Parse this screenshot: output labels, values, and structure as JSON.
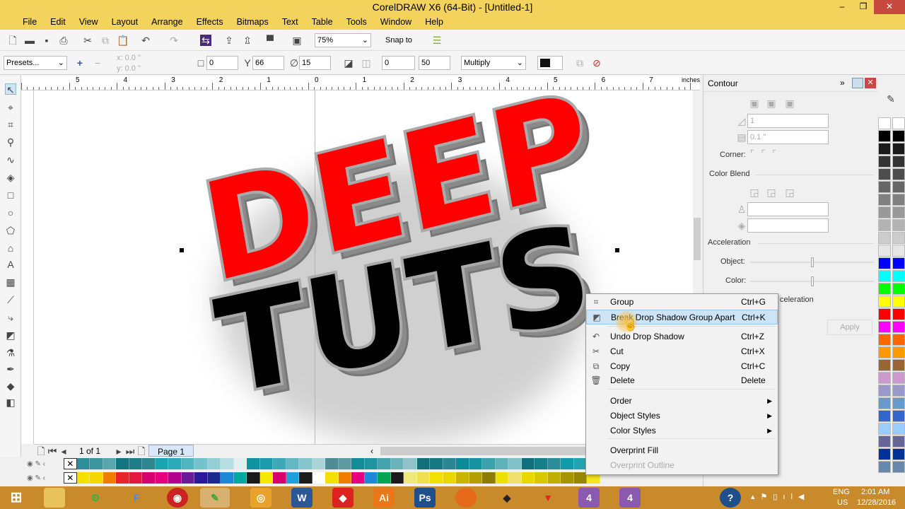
{
  "window": {
    "title": "CorelDRAW X6 (64-Bit) - [Untitled-1]",
    "minimize": "–",
    "restore": "❐",
    "close": "✕"
  },
  "menu": [
    "File",
    "Edit",
    "View",
    "Layout",
    "Arrange",
    "Effects",
    "Bitmaps",
    "Text",
    "Table",
    "Tools",
    "Window",
    "Help"
  ],
  "toolbar": {
    "zoom": "75%",
    "snap_to": "Snap to"
  },
  "property_bar": {
    "presets": "Presets...",
    "x": "x: 0.0 \"",
    "y": "y: 0.0 \"",
    "offset": "0",
    "opacity": "66",
    "feather": "15",
    "fade": "0",
    "stretch": "50",
    "merge_mode": "Multiply"
  },
  "ruler": {
    "unit": "inches",
    "labels": [
      "5",
      "4",
      "3",
      "2",
      "1",
      "0",
      "1",
      "2",
      "3",
      "4",
      "5",
      "6",
      "7"
    ]
  },
  "artwork": {
    "line1": "DEEP",
    "line2": "TUTS",
    "colors": {
      "red": "#ff0000",
      "black": "#000000",
      "extrude": "#9a9a9a"
    }
  },
  "page_nav": {
    "count": "1 of 1",
    "tab": "Page 1"
  },
  "docker": {
    "title": "Contour",
    "steps": "1",
    "offset": "0.1 \"",
    "corner": "Corner:",
    "color_blend": "Color Blend",
    "acceleration": "Acceleration",
    "object": "Object:",
    "color": "Color:",
    "link_accel": "celeration",
    "apply": "Apply",
    "object_accel": 0.5,
    "color_accel": 0.5
  },
  "context_menu": {
    "items": [
      {
        "label": "Group",
        "shortcut": "Ctrl+G",
        "icon": "group-icon"
      },
      {
        "label": "Break Drop Shadow Group Apart",
        "shortcut": "Ctrl+K",
        "icon": "break-apart-icon",
        "selected": true
      },
      {
        "label": "Undo Drop Shadow",
        "shortcut": "Ctrl+Z",
        "icon": "undo-icon"
      },
      {
        "label": "Cut",
        "shortcut": "Ctrl+X",
        "icon": "scissors-icon"
      },
      {
        "label": "Copy",
        "shortcut": "Ctrl+C",
        "icon": "copy-icon"
      },
      {
        "label": "Delete",
        "shortcut": "Delete",
        "icon": "trash-icon"
      },
      {
        "label": "Order",
        "submenu": true
      },
      {
        "label": "Object Styles",
        "submenu": true
      },
      {
        "label": "Color Styles",
        "submenu": true
      },
      {
        "label": "Overprint Fill"
      },
      {
        "label": "Overprint Outline",
        "disabled": true
      }
    ]
  },
  "palette_row1": [
    "#2f8f99",
    "#3b96a0",
    "#5aa6ae",
    "#137580",
    "#1d7d88",
    "#2e8690",
    "#19a3b3",
    "#2aaab8",
    "#4fb5c0",
    "#74c2cb",
    "#94cfd6",
    "#b5dde2",
    "#e0f0f2",
    "#0f93a3",
    "#1a9aaa",
    "#3ea9b6",
    "#62b7c2",
    "#85c5cd",
    "#a9d4da",
    "#4f8d96",
    "#5f99a1",
    "#138c98",
    "#1f939f",
    "#45a3ad",
    "#6bb3bb",
    "#90c3c9",
    "#116f7a",
    "#167a85",
    "#2a8792",
    "#0b8a98",
    "#1693a0",
    "#3aa2ad",
    "#5fb1ba",
    "#82c1c8",
    "#0f6f7b",
    "#15808c",
    "#2a8e98",
    "#109aaa",
    "#22a4b3",
    "#48b0bc"
  ],
  "palette_row2": [
    "#f5e000",
    "#f5d800",
    "#f07d00",
    "#e8232a",
    "#e5173f",
    "#d6006f",
    "#e4007e",
    "#b2008f",
    "#6a1b9a",
    "#2a1a9a",
    "#1d2a8f",
    "#1e88d8",
    "#00a99d",
    "#1a1a1a",
    "#f5e800",
    "#d6006f",
    "#1ea0dc",
    "#1a1a1a",
    "#ffffff",
    "#f5e000",
    "#f07d00",
    "#e4007e",
    "#1e88d8",
    "#00a651",
    "#1a1a1a",
    "#eee87a",
    "#f0e050",
    "#f2e000",
    "#e8d800",
    "#c9b400",
    "#b3a000",
    "#8c7d00",
    "#eee000",
    "#f0e070",
    "#e8d800",
    "#d8c800",
    "#c0ae00",
    "#a89600",
    "#988600",
    "#f6e41c"
  ],
  "right_palette": [
    "#ffffff",
    "#000000",
    "#1a1a1a",
    "#333333",
    "#4d4d4d",
    "#666666",
    "#808080",
    "#999999",
    "#b3b3b3",
    "#cccccc",
    "#e6e6e6",
    "#0000ff",
    "#00ffff",
    "#00ff00",
    "#ffff00",
    "#ff0000",
    "#ff00ff",
    "#ff6600",
    "#ff9900",
    "#996633",
    "#cc99cc",
    "#9999cc",
    "#6699cc",
    "#3366cc",
    "#99ccff",
    "#666699",
    "#003399",
    "#6688aa"
  ],
  "taskbar": {
    "apps": [
      "Ai",
      "Ps",
      "W"
    ],
    "lang": "ENG",
    "region": "US",
    "time": "2:01 AM",
    "date": "12/28/2016"
  }
}
